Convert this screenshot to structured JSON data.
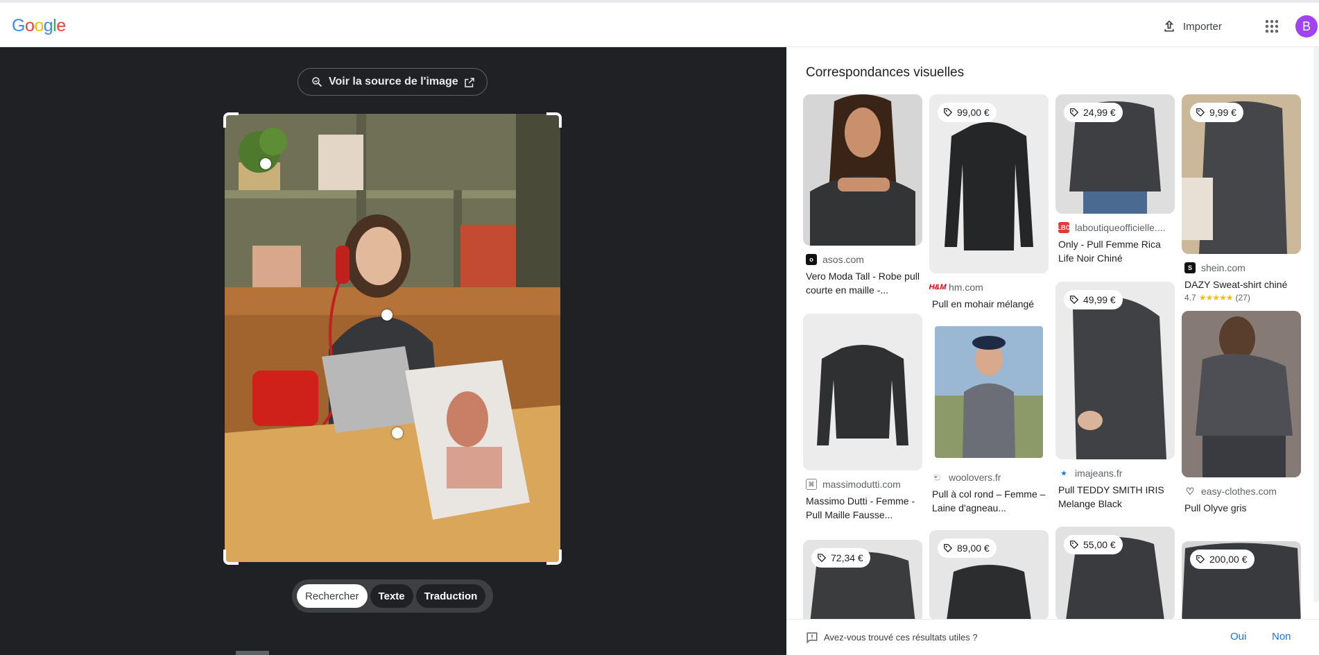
{
  "header": {
    "logo_letters": [
      "G",
      "o",
      "o",
      "g",
      "l",
      "e"
    ],
    "logo_colors": [
      "#4285f4",
      "#ea4335",
      "#fbbc05",
      "#4285f4",
      "#34a853",
      "#ea4335"
    ],
    "import_label": "Importer",
    "avatar_letter": "B"
  },
  "viewer": {
    "source_label": "Voir la source de l'image",
    "modes": [
      {
        "label": "Rechercher",
        "active": true
      },
      {
        "label": "Texte",
        "active": false
      },
      {
        "label": "Traduction",
        "active": false
      }
    ]
  },
  "results": {
    "title": "Correspondances visuelles",
    "cards": [
      {
        "price": "",
        "source": "asos.com",
        "title": "Vero Moda Tall - Robe pull courte en maille -...",
        "favicon": "asos-icon",
        "fav_color": "#111111",
        "image": "woman-dark-sweater"
      },
      {
        "price": "99,00 €",
        "source": "hm.com",
        "title": "Pull en mohair mélangé",
        "favicon": "hm-icon",
        "fav_color": "#e50010",
        "image": "dark-sweater-flat"
      },
      {
        "price": "24,99 €",
        "source": "laboutiqueofficielle....",
        "title": "Only - Pull Femme Rica Life Noir Chiné",
        "favicon": "lbo-icon",
        "fav_color": "#e53935",
        "image": "sweater-torso-jeans"
      },
      {
        "price": "9,99 €",
        "source": "shein.com",
        "title": "DAZY Sweat-shirt chiné",
        "favicon": "shein-icon",
        "fav_color": "#111111",
        "rating": "4.7",
        "reviews": "(27)",
        "image": "sweater-torso-bag"
      },
      {
        "price": "",
        "source": "massimodutti.com",
        "title": "Massimo Dutti - Femme - Pull Maille Fausse...",
        "favicon": "massimodutti-icon",
        "fav_color": "#888888",
        "image": "sweater-flat-grey"
      },
      {
        "price": "",
        "source": "woolovers.fr",
        "title": "Pull à col rond – Femme – Laine d'agneau...",
        "favicon": "woolovers-icon",
        "fav_color": "#444444",
        "image": "woman-outdoor-cap"
      },
      {
        "price": "49,99 €",
        "source": "imajeans.fr",
        "title": "Pull TEDDY SMITH IRIS Melange Black",
        "favicon": "imajeans-icon",
        "fav_color": "#1a73e8",
        "image": "sweater-torso-side"
      },
      {
        "price": "",
        "source": "easy-clothes.com",
        "title": "Pull Olyve gris",
        "favicon": "heart-icon",
        "fav_color": "#ffffff",
        "image": "woman-sitting-sweater"
      },
      {
        "price": "72,34 €",
        "source": "",
        "title": "",
        "favicon": "",
        "fav_color": "",
        "image": "sweater-crop-1"
      },
      {
        "price": "89,00 €",
        "source": "",
        "title": "",
        "favicon": "",
        "fav_color": "",
        "image": "sweater-crop-2"
      },
      {
        "price": "55,00 €",
        "source": "",
        "title": "",
        "favicon": "",
        "fav_color": "",
        "image": "sweater-crop-3"
      },
      {
        "price": "200,00 €",
        "source": "",
        "title": "",
        "favicon": "",
        "fav_color": "",
        "image": "sweater-crop-4"
      }
    ]
  },
  "feedback": {
    "question": "Avez-vous trouvé ces résultats utiles ?",
    "yes": "Oui",
    "no": "Non"
  }
}
